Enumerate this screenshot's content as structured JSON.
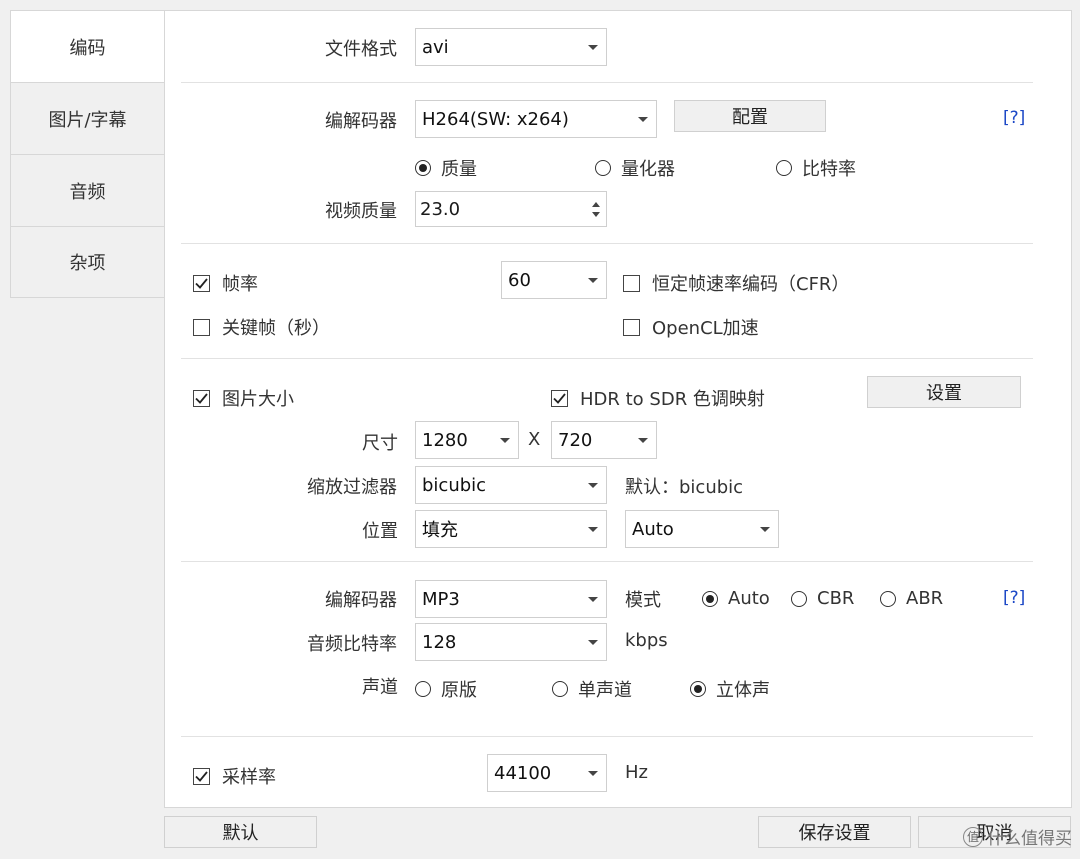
{
  "sidebar": {
    "tabs": [
      {
        "label": "编码",
        "active": true
      },
      {
        "label": "图片/字幕",
        "active": false
      },
      {
        "label": "音频",
        "active": false
      },
      {
        "label": "杂项",
        "active": false
      }
    ]
  },
  "format": {
    "label": "文件格式",
    "value": "avi"
  },
  "video": {
    "codec_label": "编解码器",
    "codec_value": "H264(SW: x264)",
    "config_button": "配置",
    "help": "[?]",
    "mode_options": [
      "质量",
      "量化器",
      "比特率"
    ],
    "mode_selected": 0,
    "quality_label": "视频质量",
    "quality_value": "23.0"
  },
  "framerate": {
    "fps_label": "帧率",
    "fps_checked": true,
    "fps_value": "60",
    "cfr_label": "恒定帧速率编码（CFR）",
    "cfr_checked": false,
    "keyframe_label": "关键帧（秒）",
    "keyframe_checked": false,
    "opencl_label": "OpenCL加速",
    "opencl_checked": false
  },
  "picture": {
    "size_label": "图片大小",
    "size_checked": true,
    "hdr_label": "HDR to SDR 色调映射",
    "hdr_checked": true,
    "settings_button": "设置",
    "dims_label": "尺寸",
    "width_value": "1280",
    "x_sep": "X",
    "height_value": "720",
    "filter_label": "缩放过滤器",
    "filter_value": "bicubic",
    "filter_default": "默认：bicubic",
    "position_label": "位置",
    "position_value": "填充",
    "position_align": "Auto"
  },
  "audio": {
    "codec_label": "编解码器",
    "codec_value": "MP3",
    "mode_label": "模式",
    "mode_options": [
      "Auto",
      "CBR",
      "ABR"
    ],
    "mode_selected": 0,
    "help": "[?]",
    "bitrate_label": "音频比特率",
    "bitrate_value": "128",
    "bitrate_unit": "kbps",
    "channel_label": "声道",
    "channel_options": [
      "原版",
      "单声道",
      "立体声"
    ],
    "channel_selected": 2
  },
  "sample": {
    "label": "采样率",
    "checked": true,
    "value": "44100",
    "unit": "Hz"
  },
  "footer": {
    "default_button": "默认",
    "save_button": "保存设置",
    "cancel_button": "取消"
  },
  "watermark": {
    "text": "什么值得买",
    "badge": "值"
  },
  "colors": {
    "help_link": "#1b47c6",
    "panel_bg": "#ffffff",
    "window_bg": "#f0f0f0"
  }
}
